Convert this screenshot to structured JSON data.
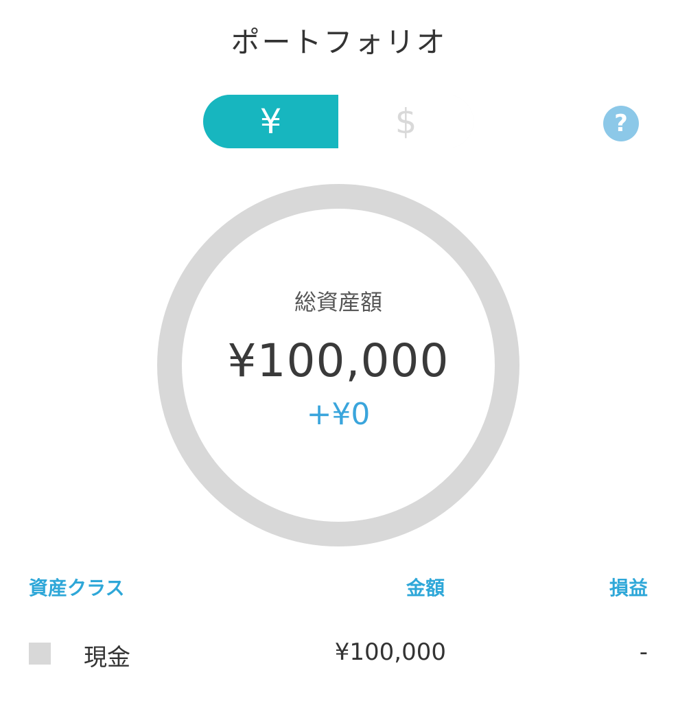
{
  "header": {
    "title": "ポートフォリオ"
  },
  "currency_toggle": {
    "options": [
      {
        "label": "¥",
        "active": true
      },
      {
        "label": "$",
        "active": false
      }
    ]
  },
  "help": {
    "label": "?"
  },
  "summary": {
    "total_label": "総資産額",
    "total_value": "¥100,000",
    "change_value": "+¥0"
  },
  "colors": {
    "accent": "#17b6bf",
    "link_blue": "#2ea7d8",
    "help_blue": "#8cc8e8",
    "ring_gray": "#d8d8d8"
  },
  "table": {
    "headers": {
      "asset_class": "資産クラス",
      "amount": "金額",
      "profit_loss": "損益"
    },
    "rows": [
      {
        "name": "現金",
        "amount": "¥100,000",
        "profit_loss": "-",
        "color": "#d8d8d8",
        "share": 1.0
      }
    ]
  }
}
